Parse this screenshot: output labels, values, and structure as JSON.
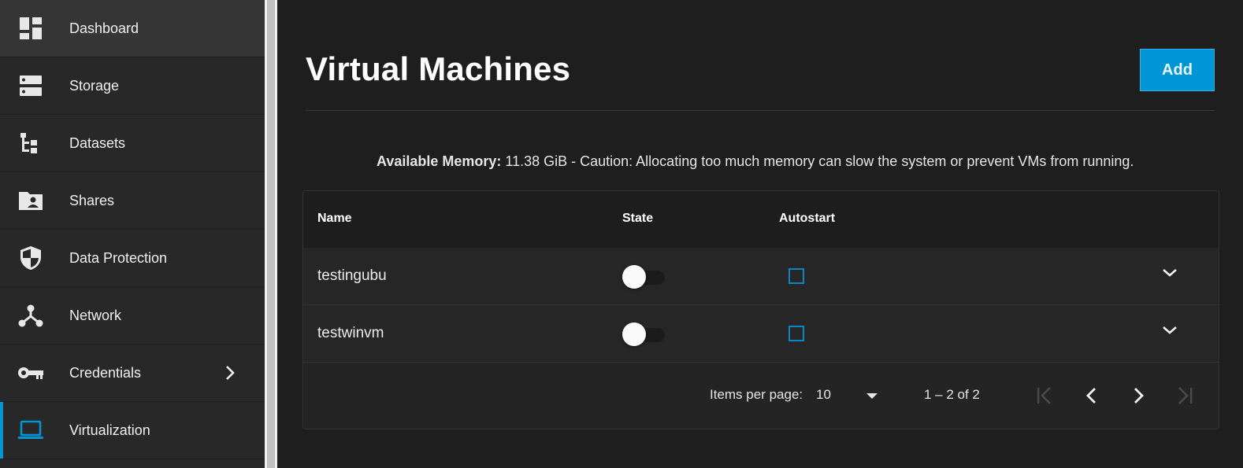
{
  "sidebar": {
    "items": [
      {
        "label": "Dashboard",
        "icon": "dashboard-icon"
      },
      {
        "label": "Storage",
        "icon": "storage-icon"
      },
      {
        "label": "Datasets",
        "icon": "datasets-icon"
      },
      {
        "label": "Shares",
        "icon": "shares-icon"
      },
      {
        "label": "Data Protection",
        "icon": "shield-icon"
      },
      {
        "label": "Network",
        "icon": "network-icon"
      },
      {
        "label": "Credentials",
        "icon": "key-icon"
      },
      {
        "label": "Virtualization",
        "icon": "laptop-icon"
      }
    ]
  },
  "colors": {
    "accent": "#0095d5",
    "background": "#1e1e1e",
    "sidebar": "#282828"
  },
  "page": {
    "title": "Virtual Machines",
    "add_label": "Add",
    "memory_label": "Available Memory:",
    "memory_text": "11.38 GiB - Caution: Allocating too much memory can slow the system or prevent VMs from running."
  },
  "table": {
    "columns": [
      "Name",
      "State",
      "Autostart"
    ],
    "rows": [
      {
        "name": "testingubu",
        "state_on": false,
        "autostart": false
      },
      {
        "name": "testwinvm",
        "state_on": false,
        "autostart": false
      }
    ]
  },
  "pager": {
    "items_per_page_label": "Items per page:",
    "items_per_page": "10",
    "range": "1 – 2 of 2"
  }
}
